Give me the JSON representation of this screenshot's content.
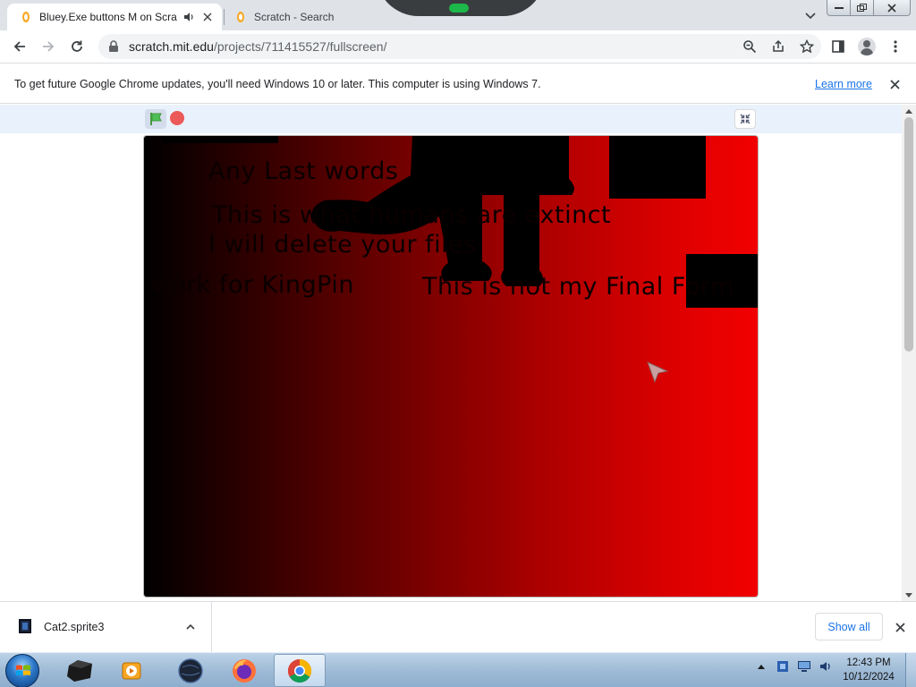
{
  "browser": {
    "tabs": [
      {
        "title": "Bluey.Exe buttons M on Scra",
        "active": true,
        "audio": true
      },
      {
        "title": "Scratch - Search",
        "active": false
      }
    ],
    "url": {
      "host": "scratch.mit.edu",
      "path": "/projects/711415527/fullscreen/"
    }
  },
  "infobar": {
    "message": "To get future Google Chrome updates, you'll need Windows 10 or later. This computer is using Windows 7.",
    "link": "Learn more"
  },
  "stage": {
    "texts": {
      "line1": "Any Last words",
      "line2": "This is what humans are extinct",
      "line3": "I will delete your files",
      "line4a": "I work for KingPin",
      "line4b": "This is not my Final Form"
    },
    "gradient_colors": [
      "#000000",
      "#7a0000",
      "#f20000"
    ]
  },
  "downloads": {
    "file": "Cat2.sprite3",
    "show_all": "Show all"
  },
  "taskbar": {
    "apps": [
      "media-app",
      "media-player",
      "globe-app",
      "firefox",
      "chrome"
    ],
    "clock": {
      "time": "12:43 PM",
      "date": "10/12/2024"
    }
  },
  "colors": {
    "accent": "#1a73e8",
    "stop": "#ec5959",
    "flag": "#4cbf56"
  }
}
